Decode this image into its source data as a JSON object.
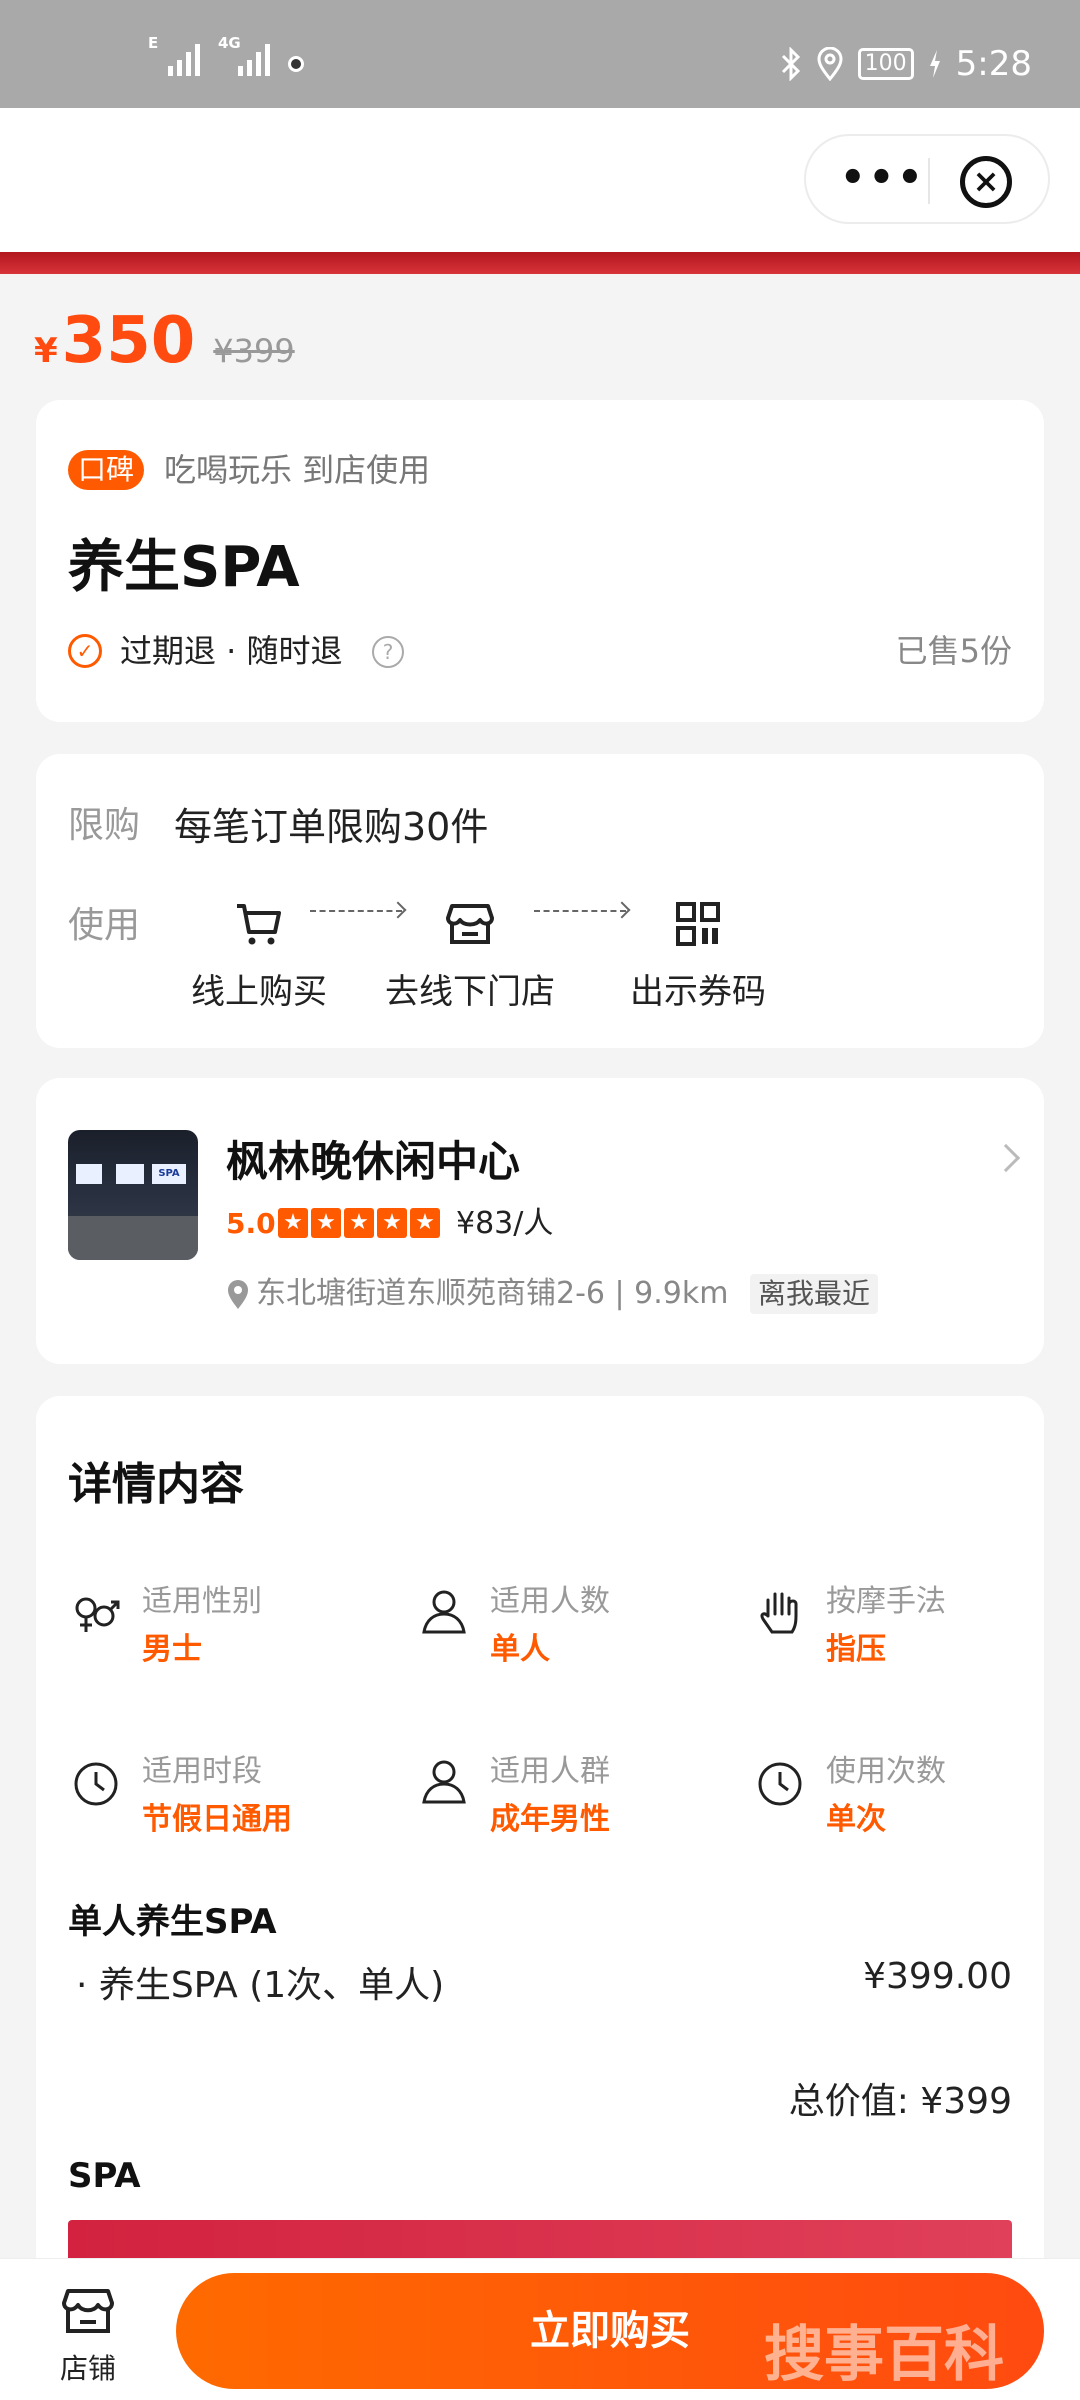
{
  "status_bar": {
    "net1": "E",
    "net2": "4G",
    "battery": "100",
    "time": "5:28"
  },
  "nav": {
    "more": "•••",
    "close": "×"
  },
  "price": {
    "currency": "¥",
    "current": "350",
    "original": "¥399"
  },
  "product": {
    "tag": "口碑",
    "category": "吃喝玩乐 到店使用",
    "title": "养生SPA",
    "refund": "过期退 · 随时退",
    "help": "?",
    "sold": "已售5份"
  },
  "usage": {
    "limit_label": "限购",
    "limit_text": "每笔订单限购30件",
    "use_label": "使用",
    "steps": [
      "线上购买",
      "去线下门店",
      "出示券码"
    ]
  },
  "shop": {
    "name": "枫林晚休闲中心",
    "rating": "5.0",
    "stars": 5,
    "per_person": "¥83/人",
    "address": "东北塘街道东顺苑商铺2-6 | 9.9km",
    "nearest": "离我最近"
  },
  "details": {
    "title": "详情内容",
    "attrs": [
      {
        "label": "适用性别",
        "value": "男士",
        "icon": "gender-icon"
      },
      {
        "label": "适用人数",
        "value": "单人",
        "icon": "person-icon"
      },
      {
        "label": "按摩手法",
        "value": "指压",
        "icon": "hand-icon"
      },
      {
        "label": "适用时段",
        "value": "节假日通用",
        "icon": "clock-icon"
      },
      {
        "label": "适用人群",
        "value": "成年男性",
        "icon": "person-icon"
      },
      {
        "label": "使用次数",
        "value": "单次",
        "icon": "clock-icon"
      }
    ],
    "package_title": "单人养生SPA",
    "item_name": "· 养生SPA (1次、单人)",
    "item_price": "¥399.00",
    "total": "总价值: ¥399",
    "spa_title": "SPA"
  },
  "bottom": {
    "store_label": "店铺",
    "buy_label": "立即购买",
    "watermark": "搜事百科"
  },
  "colors": {
    "accent": "#ff5a00",
    "price": "#ff4a10"
  }
}
